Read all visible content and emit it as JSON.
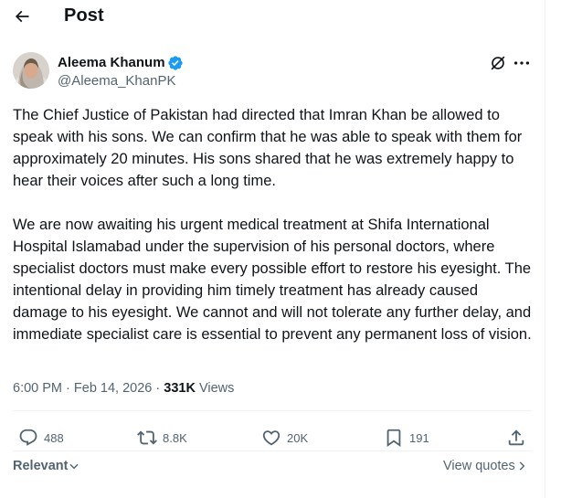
{
  "header": {
    "title": "Post"
  },
  "author": {
    "name": "Aleema Khanum",
    "handle": "@Aleema_KhanPK",
    "verified_color": "#1d9bf0"
  },
  "tweet": {
    "paragraphs": [
      "The Chief Justice of Pakistan had directed that Imran Khan be allowed to speak with his sons. We can confirm that he was able to speak with them for approximately 20 minutes. His sons shared that he was extremely happy to hear their voices after such a long time.",
      "We are now awaiting his urgent medical treatment at Shifa International Hospital Islamabad under the supervision of his personal doctors, where specialist doctors must make every possible effort to restore his eyesight. The intentional delay in providing him timely treatment has already caused damage to his eyesight. We cannot and will not tolerate any further delay, and immediate specialist care is essential to prevent any permanent loss of vision."
    ]
  },
  "meta": {
    "time": "6:00 PM",
    "separator": "·",
    "date": "Feb 14, 2026",
    "views_count": "331K",
    "views_label": "Views"
  },
  "actions": {
    "replies": "488",
    "reposts": "8.8K",
    "likes": "20K",
    "bookmarks": "191"
  },
  "replies_bar": {
    "sort_label": "Relevant",
    "quotes_label": "View quotes"
  },
  "icons": [
    "back-arrow-icon",
    "verified-badge-icon",
    "grok-icon",
    "more-icon",
    "reply-icon",
    "repost-icon",
    "like-icon",
    "bookmark-icon",
    "share-icon",
    "chevron-down-icon",
    "chevron-right-icon"
  ]
}
